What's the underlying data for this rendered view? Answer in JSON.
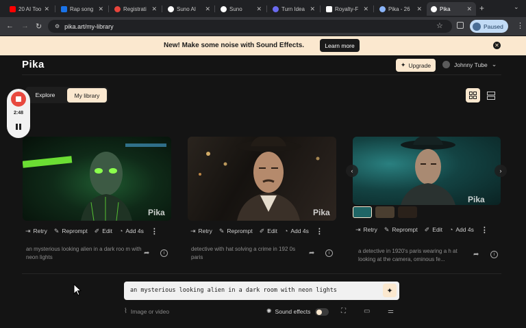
{
  "browser": {
    "tabs": [
      {
        "title": "20 AI Too",
        "color": "#ff0000",
        "active": false
      },
      {
        "title": "Rap song",
        "color": "#1a73e8",
        "active": false
      },
      {
        "title": "Registrati",
        "color": "#e8453c",
        "active": false
      },
      {
        "title": "Suno AI",
        "color": "#ffffff",
        "active": false
      },
      {
        "title": "Suno",
        "color": "#ffffff",
        "active": false
      },
      {
        "title": "Turn Idea",
        "color": "#6b6bf0",
        "active": false
      },
      {
        "title": "Royalty-F",
        "color": "#ffffff",
        "active": false
      },
      {
        "title": "Pika - 26",
        "color": "#8ab4f8",
        "active": false
      },
      {
        "title": "Pika",
        "color": "#ffffff",
        "active": true
      }
    ],
    "url": "pika.art/my-library",
    "profile_label": "Paused"
  },
  "banner": {
    "text": "New! Make some noise with Sound Effects.",
    "button": "Learn more"
  },
  "header": {
    "logo": "Pika",
    "upgrade": "Upgrade",
    "user": "Johnny Tube"
  },
  "nav": {
    "explore": "Explore",
    "library": "My library"
  },
  "recorder": {
    "time": "2:48"
  },
  "cards": [
    {
      "watermark": "Pika",
      "actions": [
        "Retry",
        "Reprompt",
        "Edit",
        "Add 4s"
      ],
      "prompt": "an mysterious looking alien in a dark roo m with neon lights"
    },
    {
      "watermark": "Pika",
      "actions": [
        "Retry",
        "Reprompt",
        "Edit",
        "Add 4s"
      ],
      "prompt": "detective with hat solving a crime in 192 0s paris"
    },
    {
      "watermark": "Pika",
      "actions": [
        "Retry",
        "Reprompt",
        "Edit",
        "Add 4s"
      ],
      "prompt": "a detective in 1920's paris wearing a h at looking at the camera, ominous fe..."
    }
  ],
  "composer": {
    "prompt": "an mysterious looking alien in a dark room with neon lights",
    "image_label": "Image or video",
    "sound_label": "Sound effects"
  }
}
